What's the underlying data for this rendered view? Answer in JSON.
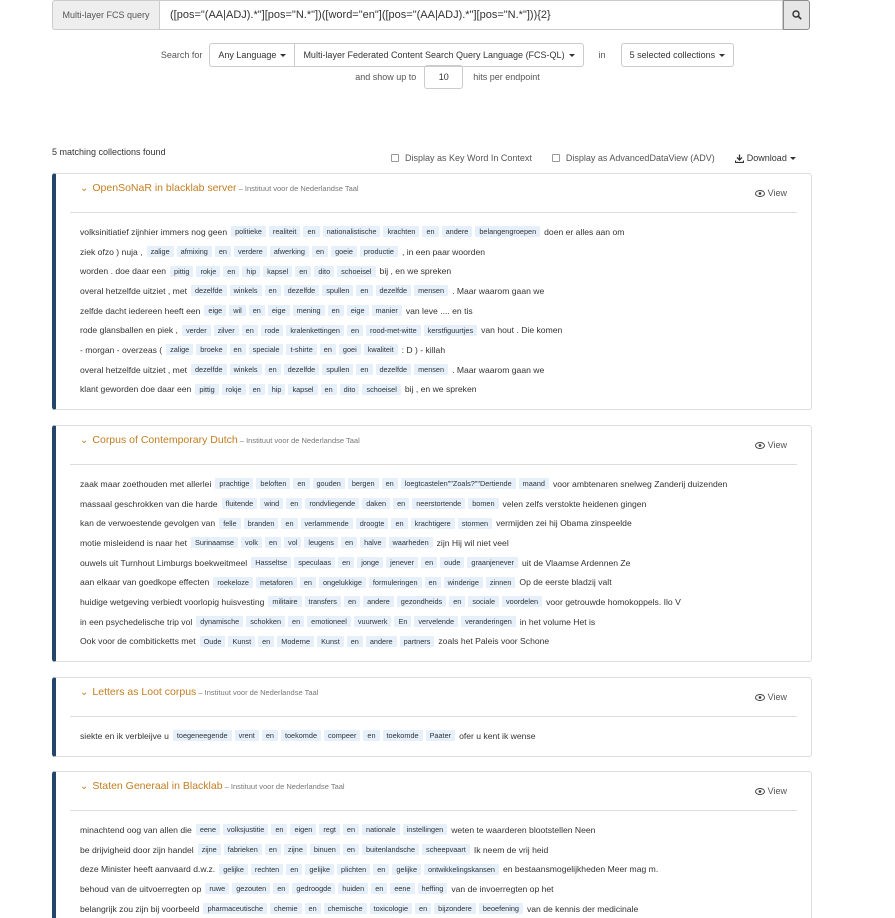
{
  "query_bar": {
    "label": "Multi-layer FCS query",
    "query": "([pos=\"(AA|ADJ).*\"][pos=\"N.*\"])([word=\"en\"]([pos=\"(AA|ADJ).*\"][pos=\"N.*\"])){2}",
    "search_icon": "search-icon"
  },
  "search_options": {
    "search_for_label": "Search for",
    "language": "Any Language",
    "query_language": "Multi-layer Federated Content Search Query Language (FCS-QL)",
    "in_label": "in",
    "collections": "5 selected collections",
    "show_up_to_label": "and show up to",
    "hits_value": "10",
    "hits_suffix": "hits per endpoint"
  },
  "results_header": {
    "matching_text": "5 matching collections found",
    "kwic_label": "Display as Key Word In Context",
    "adv_label": "Display as AdvancedDataView (ADV)",
    "download_label": "Download"
  },
  "colors": {
    "accent_border": "#24466b",
    "title": "#c27e21",
    "hit_bg": "#e5f0fb"
  },
  "panels": [
    {
      "title": "OpenSoNaR in blacklab server",
      "institution": "Instituut voor de Nederlandse Taal",
      "view_label": "View",
      "rows": [
        {
          "left": "volksinitiatief zijnhier immers nog geen",
          "hits": [
            "politieke",
            "realiteit",
            "en",
            "nationalistische",
            "krachten",
            "en",
            "andere",
            "belangengroepen"
          ],
          "right": "doen er alles aan om"
        },
        {
          "left": "ziek ofzo ) nuja ,",
          "hits": [
            "zalige",
            "afmixing",
            "en",
            "verdere",
            "afwerking",
            "en",
            "goeie",
            "productie"
          ],
          "right": ", in een paar woorden"
        },
        {
          "left": "worden . doe daar een",
          "hits": [
            "pittig",
            "rokje",
            "en",
            "hip",
            "kapsel",
            "en",
            "dito",
            "schoeisel"
          ],
          "right": "bij , en we spreken"
        },
        {
          "left": "overal hetzelfde uitziet , met",
          "hits": [
            "dezelfde",
            "winkels",
            "en",
            "dezelfde",
            "spullen",
            "en",
            "dezelfde",
            "mensen"
          ],
          "right": ". Maar waarom gaan we"
        },
        {
          "left": "zelfde dacht iedereen heeft een",
          "hits": [
            "eige",
            "wil",
            "en",
            "eige",
            "mening",
            "en",
            "eige",
            "manier"
          ],
          "right": "van leve .... en tis"
        },
        {
          "left": "rode glansballen en piek ,",
          "hits": [
            "verder",
            "zilver",
            "en",
            "rode",
            "kralenkettingen",
            "en",
            "rood-met-witte",
            "kerstfiguurtjes"
          ],
          "right": "van hout . Die komen"
        },
        {
          "left": "- morgan - overzeas (",
          "hits": [
            "zalige",
            "broeke",
            "en",
            "speciale",
            "t-shirte",
            "en",
            "goei",
            "kwaliteit"
          ],
          "right": ": D ) - killah"
        },
        {
          "left": "overal hetzelfde uitziet , met",
          "hits": [
            "dezelfde",
            "winkels",
            "en",
            "dezelfde",
            "spullen",
            "en",
            "dezelfde",
            "mensen"
          ],
          "right": ". Maar waarom gaan we"
        },
        {
          "left": "klant geworden doe daar een",
          "hits": [
            "pittig",
            "rokje",
            "en",
            "hip",
            "kapsel",
            "en",
            "dito",
            "schoeisel"
          ],
          "right": "bij , en we spreken"
        }
      ]
    },
    {
      "title": "Corpus of Contemporary Dutch",
      "institution": "Instituut voor de Nederlandse Taal",
      "view_label": "View",
      "rows": [
        {
          "left": "zaak maar zoethouden met allerlei",
          "hits": [
            "prachtige",
            "beloften",
            "en",
            "gouden",
            "bergen",
            "en",
            "loegtcastelen\"\"Zoals?\"\"Dertiende",
            "maand"
          ],
          "right": "voor ambtenaren snelweg Zanderij duizenden"
        },
        {
          "left": "massaal geschrokken van die harde",
          "hits": [
            "fluitende",
            "wind",
            "en",
            "rondvliegende",
            "daken",
            "en",
            "neerstortende",
            "bomen"
          ],
          "right": "velen zelfs verstokte heidenen gingen"
        },
        {
          "left": "kan de verwoestende gevolgen van",
          "hits": [
            "felle",
            "branden",
            "en",
            "verlammende",
            "droogte",
            "en",
            "krachtigere",
            "stormen"
          ],
          "right": "vermijden zei hij Obama zinspeelde"
        },
        {
          "left": "motie misleidend is naar het",
          "hits": [
            "Surinaamse",
            "volk",
            "en",
            "vol",
            "leugens",
            "en",
            "halve",
            "waarheden"
          ],
          "right": "zijn Hij wil niet veel"
        },
        {
          "left": "ouwels uit Turnhout Limburgs boekweitmeel",
          "hits": [
            "Hasseltse",
            "speculaas",
            "en",
            "jonge",
            "jenever",
            "en",
            "oude",
            "graanjenever"
          ],
          "right": "uit de Vlaamse Ardennen Ze"
        },
        {
          "left": "aan elkaar van goedkope effecten",
          "hits": [
            "roekeloze",
            "metaforen",
            "en",
            "ongelukkige",
            "formuleringen",
            "en",
            "winderige",
            "zinnen"
          ],
          "right": "Op de eerste bladzij valt"
        },
        {
          "left": "huidige wetgeving verbiedt voorlopig huisvesting",
          "hits": [
            "militaire",
            "transfers",
            "en",
            "andere",
            "gezondheids",
            "en",
            "sociale",
            "voordelen"
          ],
          "right": "voor getrouwde homokoppels. Ilo V"
        },
        {
          "left": "in een psychedelische trip vol",
          "hits": [
            "dynamische",
            "schokken",
            "en",
            "emotioneel",
            "vuurwerk",
            "En",
            "vervelende",
            "veranderingen"
          ],
          "right": "in het volume Het is"
        },
        {
          "left": "Ook voor de combiticketts met",
          "hits": [
            "Oude",
            "Kunst",
            "en",
            "Moderne",
            "Kunst",
            "en",
            "andere",
            "partners"
          ],
          "right": "zoals het Paleis voor Schone"
        }
      ]
    },
    {
      "title": "Letters as Loot corpus",
      "institution": "Instituut voor de Nederlandse Taal",
      "view_label": "View",
      "rows": [
        {
          "left": "siekte en ik verbleijve u",
          "hits": [
            "toegeneegende",
            "vrent",
            "en",
            "toekomde",
            "compeer",
            "en",
            "toekomde",
            "Paater"
          ],
          "right": "ofer u kent ik wense"
        }
      ]
    },
    {
      "title": "Staten Generaal in Blacklab",
      "institution": "Instituut voor de Nederlandse Taal",
      "view_label": "View",
      "rows": [
        {
          "left": "minachtend oog van allen die",
          "hits": [
            "eene",
            "volksjustitie",
            "en",
            "eigen",
            "regt",
            "en",
            "nationale",
            "instellingen"
          ],
          "right": "weten te waarderen blootstellen Neen"
        },
        {
          "left": "be drijvigheid door zijn handel",
          "hits": [
            "zijne",
            "fabrieken",
            "en",
            "zijne",
            "binuen",
            "en",
            "buitenlandsche",
            "scheepvaart"
          ],
          "right": "Ik neem de vrij heid"
        },
        {
          "left": "deze Minister heeft aanvaard d.w.z.",
          "hits": [
            "gelijke",
            "rechten",
            "en",
            "gelijke",
            "plichten",
            "en",
            "gelijke",
            "ontwikkelingskansen"
          ],
          "right": "en bestaansmogelijkheden Meer mag m."
        },
        {
          "left": "behoud van de uitvoerregten op",
          "hits": [
            "ruwe",
            "gezouten",
            "en",
            "gedroogde",
            "huiden",
            "en",
            "eene",
            "heffing"
          ],
          "right": "van de invoerregten op het"
        },
        {
          "left": "belangrijk zou zijn bij voorbeeld",
          "hits": [
            "pharmaceutische",
            "chemie",
            "en",
            "chemische",
            "toxicologie",
            "en",
            "bijzondere",
            "beoefening"
          ],
          "right": "van de kennis der medicinale"
        }
      ]
    }
  ]
}
